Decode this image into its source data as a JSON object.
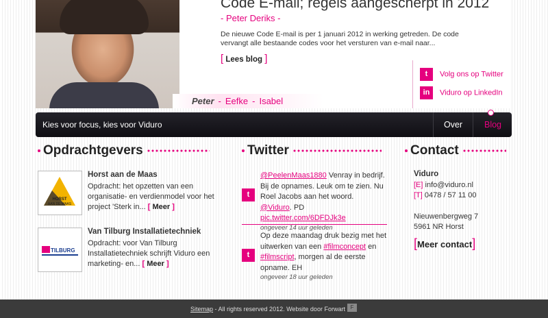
{
  "blog": {
    "title": "Code E-mail; regels aangescherpt in 2012",
    "author": "- Peter Deriks -",
    "excerpt": "De nieuwe Code E-mail is per 1 januari 2012 in werking getreden. De code vervangt alle bestaande codes voor het versturen van e-mail naar...",
    "read_more": "Lees blog"
  },
  "people": {
    "active": "Peter",
    "others": [
      "Eefke",
      "Isabel"
    ],
    "separator": "-"
  },
  "social": {
    "twitter": "Volg ons op Twitter",
    "linkedin": "Viduro op LinkedIn"
  },
  "nav": {
    "tagline": "Kies voor focus, kies voor Viduro",
    "items": [
      "Over",
      "Blog"
    ],
    "active": "Blog"
  },
  "sections": {
    "clients": "Opdrachtgevers",
    "twitter": "Twitter",
    "contact": "Contact"
  },
  "clients": [
    {
      "name": "Horst aan de Maas",
      "desc": "Opdracht: het opzetten van een organisatie- en verdienmodel voor het project 'Sterk in...",
      "more": "Meer",
      "logo_text": "HORST AAN DE MAAS"
    },
    {
      "name": "Van Tilburg Installatietechniek",
      "desc": "Opdracht: voor Van Tilburg Installatietechniek schrijft Viduro een marketing- en...",
      "more": "Meer",
      "logo_text": "VAN TILBURG"
    }
  ],
  "tweets": [
    {
      "handle": "@PeelenMaas1880",
      "t1": " Venray in bedrijf. Bij de opnames. Leuk om te zien. Nu Roel Jacobs aan het woord. ",
      "mention": "@Viduro",
      "t2": ". PD ",
      "link": "pic.twitter.com/6DFDJk3e",
      "time": "ongeveer 14 uur geleden"
    },
    {
      "t1": "Op deze maandag druk bezig met het uitwerken van een ",
      "hash1": "#filmconcept",
      "t2": " en ",
      "hash2": "#filmscript",
      "t3": ", morgen al de eerste opname. EH",
      "time": "ongeveer 18 uur geleden"
    }
  ],
  "contact": {
    "company": "Viduro",
    "email_label": "[E]",
    "email": "info@viduro.nl",
    "phone_label": "[T]",
    "phone": "0478 / 57 11 00",
    "street": "Nieuwenbergweg 7",
    "city": "5961 NR Horst",
    "more": "Meer contact"
  },
  "footer": {
    "sitemap": "Sitemap",
    "text": " - All rights reserved 2012. Website door Forwart"
  },
  "colors": {
    "accent": "#e5007e",
    "nav_bg": "#141318",
    "footer_bg": "#3b3b3b"
  }
}
